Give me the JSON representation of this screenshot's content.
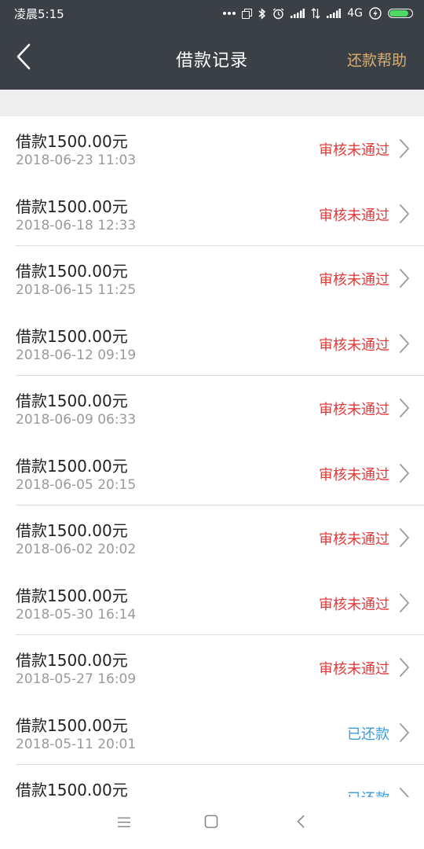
{
  "status_bar": {
    "time": "凌晨5:15",
    "network": "4G",
    "icons": [
      "more-dots-icon",
      "copy-icon",
      "bluetooth-icon",
      "alarm-icon",
      "signal-icon",
      "transfer-icon",
      "signal-icon",
      "charging-icon",
      "battery-icon"
    ],
    "battery_level": 0.85
  },
  "header": {
    "title": "借款记录",
    "help_label": "还款帮助",
    "back_icon": "back-arrow-icon"
  },
  "loans": [
    {
      "amount": "借款1500.00元",
      "date": "2018-06-23 11:03",
      "status": "审核未通过",
      "status_color": "#e03a3a"
    },
    {
      "amount": "借款1500.00元",
      "date": "2018-06-18 12:33",
      "status": "审核未通过",
      "status_color": "#e03a3a"
    },
    {
      "amount": "借款1500.00元",
      "date": "2018-06-15 11:25",
      "status": "审核未通过",
      "status_color": "#e03a3a"
    },
    {
      "amount": "借款1500.00元",
      "date": "2018-06-12 09:19",
      "status": "审核未通过",
      "status_color": "#e03a3a"
    },
    {
      "amount": "借款1500.00元",
      "date": "2018-06-09 06:33",
      "status": "审核未通过",
      "status_color": "#e03a3a"
    },
    {
      "amount": "借款1500.00元",
      "date": "2018-06-05 20:15",
      "status": "审核未通过",
      "status_color": "#e03a3a"
    },
    {
      "amount": "借款1500.00元",
      "date": "2018-06-02 20:02",
      "status": "审核未通过",
      "status_color": "#e03a3a"
    },
    {
      "amount": "借款1500.00元",
      "date": "2018-05-30 16:14",
      "status": "审核未通过",
      "status_color": "#e03a3a"
    },
    {
      "amount": "借款1500.00元",
      "date": "2018-05-27 16:09",
      "status": "审核未通过",
      "status_color": "#e03a3a"
    },
    {
      "amount": "借款1500.00元",
      "date": "2018-05-11 20:01",
      "status": "已还款",
      "status_color": "#3a9be0"
    },
    {
      "amount": "借款1500.00元",
      "date": "",
      "status": "已还款",
      "status_color": "#3a9be0"
    }
  ],
  "bottom_nav": {
    "icons": [
      "menu-icon",
      "home-square-icon",
      "back-chevron-icon"
    ]
  },
  "colors": {
    "header_bg": "#3b4046",
    "help_accent": "#d9ae6c",
    "rejected": "#e03a3a",
    "repaid": "#3a9be0"
  }
}
